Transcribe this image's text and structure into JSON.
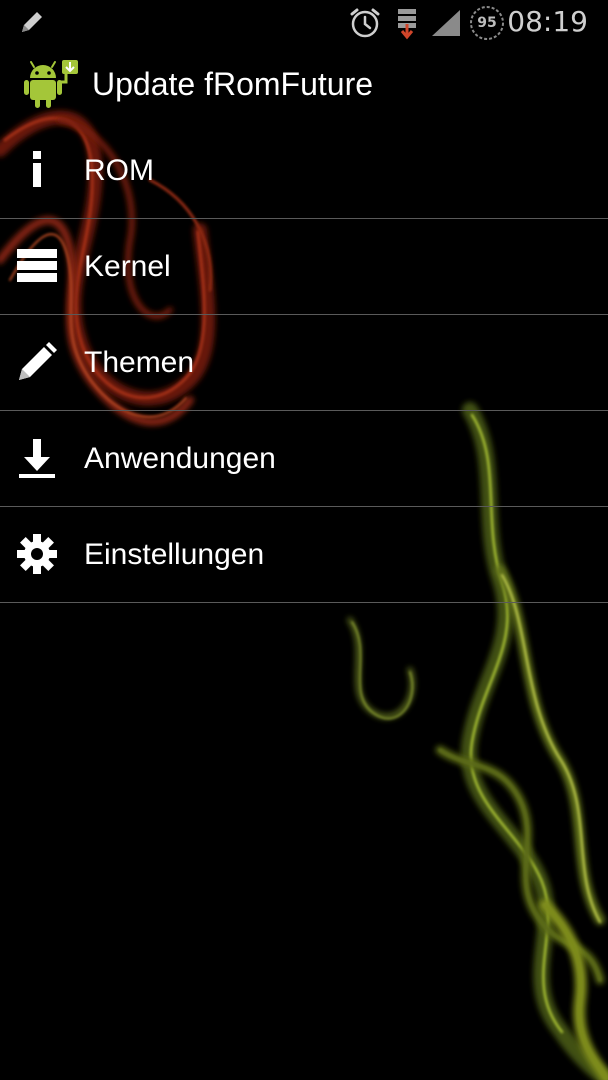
{
  "status_bar": {
    "clock": "08:19",
    "battery_level": "95",
    "icons": [
      "pencil-icon",
      "alarm-icon",
      "download-icon",
      "signal-icon",
      "battery-icon"
    ]
  },
  "app_bar": {
    "title": "Update fRomFuture",
    "icon": "android-update-icon"
  },
  "menu": {
    "items": [
      {
        "label": "ROM",
        "icon": "info-icon"
      },
      {
        "label": "Kernel",
        "icon": "list-icon"
      },
      {
        "label": "Themen",
        "icon": "pencil-icon"
      },
      {
        "label": "Anwendungen",
        "icon": "download-icon"
      },
      {
        "label": "Einstellungen",
        "icon": "gear-icon"
      }
    ]
  },
  "colors": {
    "background": "#000000",
    "text": "#ffffff",
    "divider": "#5a5a5a",
    "android_green": "#a4c639",
    "smoke_red": "#b8321a",
    "smoke_green": "#c8e04a"
  }
}
